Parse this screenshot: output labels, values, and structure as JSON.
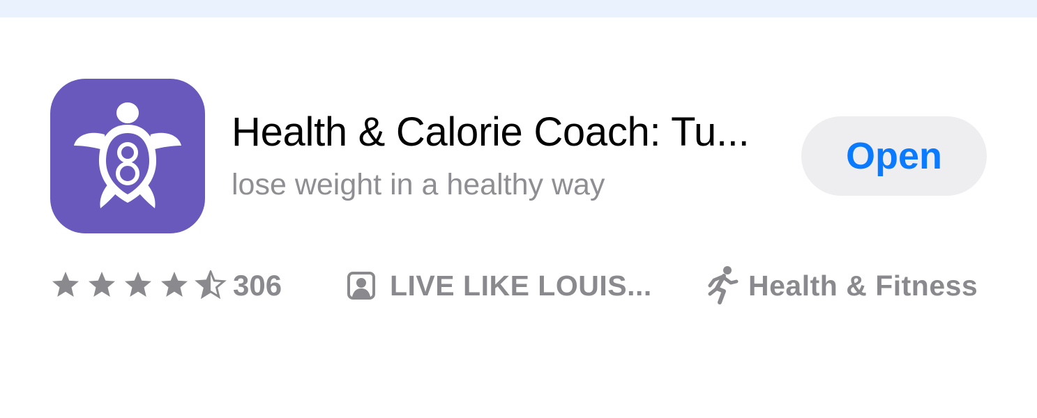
{
  "app": {
    "title": "Health & Calorie Coach: Tu...",
    "subtitle": "lose weight in a healthy way",
    "icon": "turtle-logo-icon",
    "icon_color": "#6a59bd",
    "action_label": "Open",
    "action_color": "#0a7aff"
  },
  "rating": {
    "stars": 4.5,
    "max_stars": 5,
    "count": "306",
    "icon": "star-icon"
  },
  "developer": {
    "name": "LIVE LIKE LOUIS...",
    "icon": "person-square-icon"
  },
  "category": {
    "name": "Health & Fitness",
    "icon": "running-figure-icon"
  },
  "colors": {
    "top_bar": "#eaf3fd",
    "meta_text": "#8a8a8e",
    "subtitle_text": "#8e8e93"
  }
}
